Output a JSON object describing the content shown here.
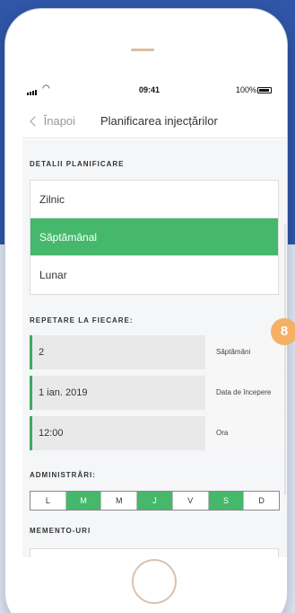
{
  "status_bar": {
    "time": "09:41",
    "battery": "100%"
  },
  "nav": {
    "back_label": "Înapoi",
    "title": "Planificarea injecțărilor"
  },
  "planning": {
    "section_title": "DETALII PLANIFICARE",
    "options": [
      {
        "label": "Zilnic",
        "selected": false
      },
      {
        "label": "Săptămânal",
        "selected": true
      },
      {
        "label": "Lunar",
        "selected": false
      }
    ]
  },
  "repeat": {
    "section_title": "REPETARE LA FIECARE:",
    "rows": [
      {
        "value": "2",
        "label": "Săptămâni"
      },
      {
        "value": "1 ian. 2019",
        "label": "Data de începere"
      },
      {
        "value": "12:00",
        "label": "Ora"
      }
    ]
  },
  "administrations": {
    "section_title": "ADMINISTRĂRI:",
    "days": [
      {
        "label": "L",
        "active": false
      },
      {
        "label": "M",
        "active": true
      },
      {
        "label": "M",
        "active": false
      },
      {
        "label": "J",
        "active": true
      },
      {
        "label": "V",
        "active": false
      },
      {
        "label": "S",
        "active": true
      },
      {
        "label": "D",
        "active": false
      }
    ]
  },
  "reminders": {
    "section_title": "MEMENTO-URI"
  },
  "badge": {
    "number": "8"
  },
  "colors": {
    "accent_green": "#45b86b",
    "badge_orange": "#f4b064",
    "background_blue": "#2f56a8"
  },
  "icons": [
    "signal-icon",
    "wifi-icon",
    "battery-icon",
    "chevron-left-icon"
  ]
}
